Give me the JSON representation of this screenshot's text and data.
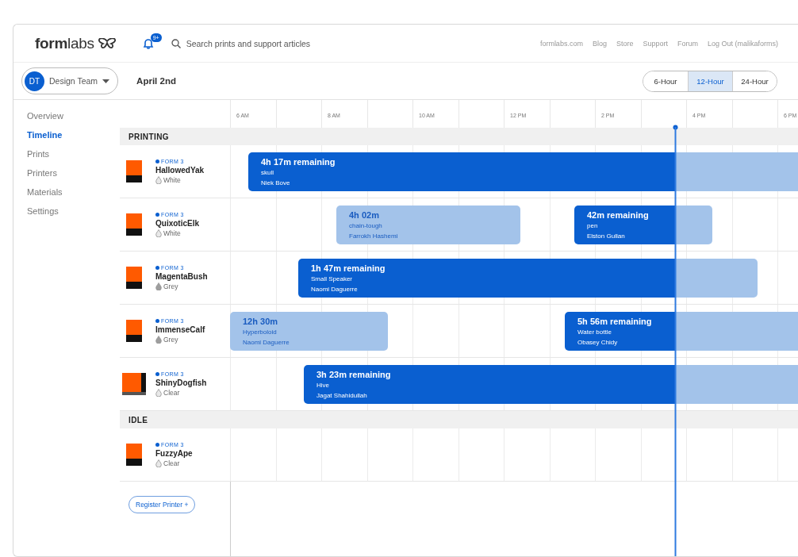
{
  "header": {
    "logo": "**form**labs",
    "notifications_badge": "9+",
    "search": {
      "placeholder": "Search prints and support articles"
    },
    "links": [
      "formlabs.com",
      "Blog",
      "Store",
      "Support",
      "Forum",
      "Log Out (malikaforms)"
    ]
  },
  "toolbar": {
    "team": {
      "initials": "DT",
      "name": "Design Team"
    },
    "date": "April 2nd",
    "scale_options": [
      {
        "label": "6-Hour",
        "selected": false
      },
      {
        "label": "12-Hour",
        "selected": true
      },
      {
        "label": "24-Hour",
        "selected": false
      }
    ]
  },
  "sidebar": {
    "items": [
      {
        "label": "Overview",
        "selected": false
      },
      {
        "label": "Timeline",
        "selected": true
      },
      {
        "label": "Prints",
        "selected": false
      },
      {
        "label": "Printers",
        "selected": false
      },
      {
        "label": "Materials",
        "selected": false
      },
      {
        "label": "Settings",
        "selected": false
      }
    ]
  },
  "time_axis": [
    "6 AM",
    "8 AM",
    "10 AM",
    "12 PM",
    "2 PM",
    "4 PM",
    "6 PM"
  ],
  "sections": [
    {
      "title": "PRINTING",
      "printers": [
        {
          "model": "FORM 3",
          "name": "HallowedYak",
          "kind": "standard",
          "material": {
            "label": "White",
            "color": "#e8e8e8"
          },
          "jobs": [
            {
              "kind": "printing",
              "time": "4h 17m remaining",
              "part": "skull",
              "owner": "Niek Bove"
            }
          ]
        },
        {
          "model": "FORM 3",
          "name": "QuixoticElk",
          "kind": "standard",
          "material": {
            "label": "White",
            "color": "#e8e8e8"
          },
          "jobs": [
            {
              "kind": "completed",
              "time": "4h 02m",
              "part": "chain-tough",
              "owner": "Farrokh Hashemi"
            },
            {
              "kind": "printing",
              "time": "42m remaining",
              "part": "pen",
              "owner": "Elston Gullan"
            }
          ]
        },
        {
          "model": "FORM 3",
          "name": "MagentaBush",
          "kind": "standard",
          "material": {
            "label": "Grey",
            "color": "#9e9e9e"
          },
          "jobs": [
            {
              "kind": "printing",
              "time": "1h 47m remaining",
              "part": "Small Speaker",
              "owner": "Naomi Daguerre"
            }
          ]
        },
        {
          "model": "FORM 3",
          "name": "ImmenseCalf",
          "kind": "standard",
          "material": {
            "label": "Grey",
            "color": "#9e9e9e"
          },
          "jobs": [
            {
              "kind": "completed",
              "time": "12h 30m",
              "part": "Hyperboloid",
              "owner": "Naomi Daguerre"
            },
            {
              "kind": "printing",
              "time": "5h 56m remaining",
              "part": "Water bottle",
              "owner": "Obasey Chidy"
            }
          ]
        },
        {
          "model": "FORM 3",
          "name": "ShinyDogfish",
          "kind": "large",
          "material": {
            "label": "Clear",
            "color": "#e8e8e8"
          },
          "jobs": [
            {
              "kind": "printing",
              "time": "3h 23m remaining",
              "part": "Hive",
              "owner": "Jagat Shahidullah"
            }
          ]
        }
      ]
    },
    {
      "title": "IDLE",
      "printers": [
        {
          "model": "FORM 3",
          "name": "FuzzyApe",
          "kind": "standard",
          "material": {
            "label": "Clear",
            "color": "#e8e8e8"
          }
        }
      ]
    }
  ],
  "register_button": "Register Printer +"
}
